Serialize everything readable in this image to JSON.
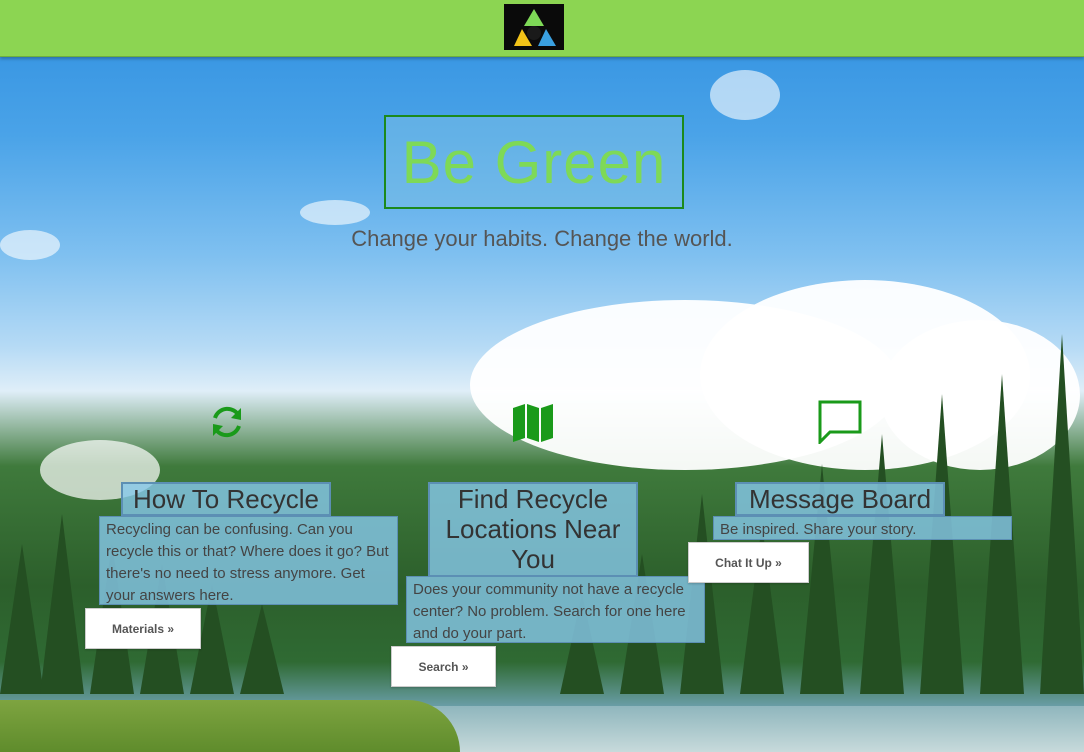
{
  "header": {
    "logo_icon": "recycle-logo-icon"
  },
  "hero": {
    "title": "Be Green",
    "tagline": "Change your habits. Change the world."
  },
  "colors": {
    "topbar": "#8cd552",
    "accent_green": "#1c8a1c",
    "title_green": "#7ed957"
  },
  "columns": [
    {
      "icon": "refresh-icon",
      "title": "How To Recycle",
      "text": "Recycling can be confusing. Can you recycle this or that? Where does it go? But there's no need to stress anymore. Get your answers here.",
      "button": "Materials »"
    },
    {
      "icon": "map-icon",
      "title": "Find Recycle Locations Near You",
      "text": "Does your community not have a recycle center? No problem. Search for one here and do your part.",
      "button": "Search »"
    },
    {
      "icon": "message-icon",
      "title": "Message Board",
      "text": "Be inspired. Share your story.",
      "button": "Chat It Up »"
    }
  ]
}
